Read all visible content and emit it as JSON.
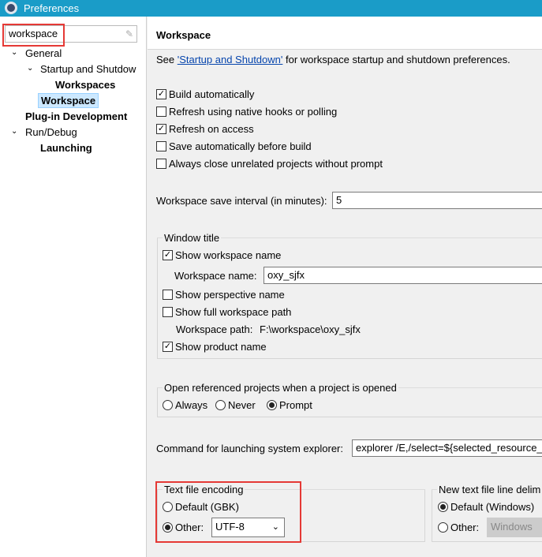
{
  "window": {
    "title": "Preferences",
    "icon": "gear-icon"
  },
  "filter": {
    "value": "workspace",
    "clear_icon": "eraser-icon"
  },
  "tree": [
    {
      "label": "General",
      "expanded": true
    },
    {
      "label": "Startup and Shutdow",
      "expanded": true
    },
    {
      "label": "Workspaces"
    },
    {
      "label": "Workspace",
      "selected": true
    },
    {
      "label": "Plug-in Development"
    },
    {
      "label": "Run/Debug",
      "expanded": true
    },
    {
      "label": "Launching"
    }
  ],
  "page": {
    "title": "Workspace",
    "see_prefix": "See ",
    "see_link": "'Startup and Shutdown'",
    "see_suffix": " for workspace startup and shutdown preferences.",
    "checks": [
      {
        "label": "Build automatically",
        "checked": true
      },
      {
        "label": "Refresh using native hooks or polling",
        "checked": false
      },
      {
        "label": "Refresh on access",
        "checked": true
      },
      {
        "label": "Save automatically before build",
        "checked": false
      },
      {
        "label": "Always close unrelated projects without prompt",
        "checked": false
      }
    ],
    "save_interval_label": "Workspace save interval (in minutes):",
    "save_interval_value": "5",
    "window_title": {
      "legend": "Window title",
      "show_name": "Show workspace name",
      "name_label": "Workspace name:",
      "name_value": "oxy_sjfx",
      "show_perspective": "Show perspective name",
      "show_path": "Show full workspace path",
      "path_label": "Workspace path:",
      "path_value": "F:\\workspace\\oxy_sjfx",
      "show_product": "Show product name"
    },
    "open_ref": {
      "legend": "Open referenced projects when a project is opened",
      "options": [
        "Always",
        "Never",
        "Prompt"
      ],
      "selected": "Prompt"
    },
    "explorer_label": "Command for launching system explorer:",
    "explorer_value": "explorer /E,/select=${selected_resource_l",
    "encoding": {
      "legend": "Text file encoding",
      "default": "Default (GBK)",
      "other": "Other:",
      "value": "UTF-8",
      "selected": "Other"
    },
    "delimiter": {
      "legend": "New text file line delim",
      "default": "Default (Windows)",
      "other": "Other:",
      "value": "Windows",
      "selected": "Default"
    }
  },
  "colors": {
    "titlebar": "#1a9cc8",
    "highlight": "#e53935",
    "selection": "#cce8ff",
    "link": "#0645ad"
  }
}
